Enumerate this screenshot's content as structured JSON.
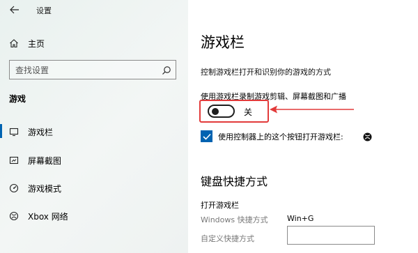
{
  "window": {
    "title": "设置"
  },
  "sidebar": {
    "home_label": "主页",
    "search_placeholder": "查找设置",
    "section_title": "游戏",
    "items": [
      {
        "label": "游戏栏",
        "icon": "gamebar-icon",
        "selected": true
      },
      {
        "label": "屏幕截图",
        "icon": "captures-icon",
        "selected": false
      },
      {
        "label": "游戏模式",
        "icon": "gamemode-icon",
        "selected": false
      },
      {
        "label": "Xbox 网络",
        "icon": "xbox-icon",
        "selected": false
      }
    ]
  },
  "main": {
    "title": "游戏栏",
    "description": "控制游戏栏打开和识别你的游戏的方式",
    "record_setting": {
      "label": "使用游戏栏录制游戏剪辑、屏幕截图和广播",
      "toggle_state_text": "关",
      "toggle_on": false
    },
    "controller_setting": {
      "label": "使用控制器上的这个按钮打开游戏栏:",
      "checked": true,
      "icon": "xbox-logo-icon"
    },
    "keyboard": {
      "title": "键盘快捷方式",
      "subtitle": "打开游戏栏",
      "windows_shortcut_label": "Windows 快捷方式",
      "windows_shortcut_value": "Win+G",
      "custom_shortcut_label": "自定义快捷方式",
      "custom_shortcut_value": ""
    }
  },
  "colors": {
    "accent": "#0063b1",
    "highlight": "#e23a3a"
  }
}
